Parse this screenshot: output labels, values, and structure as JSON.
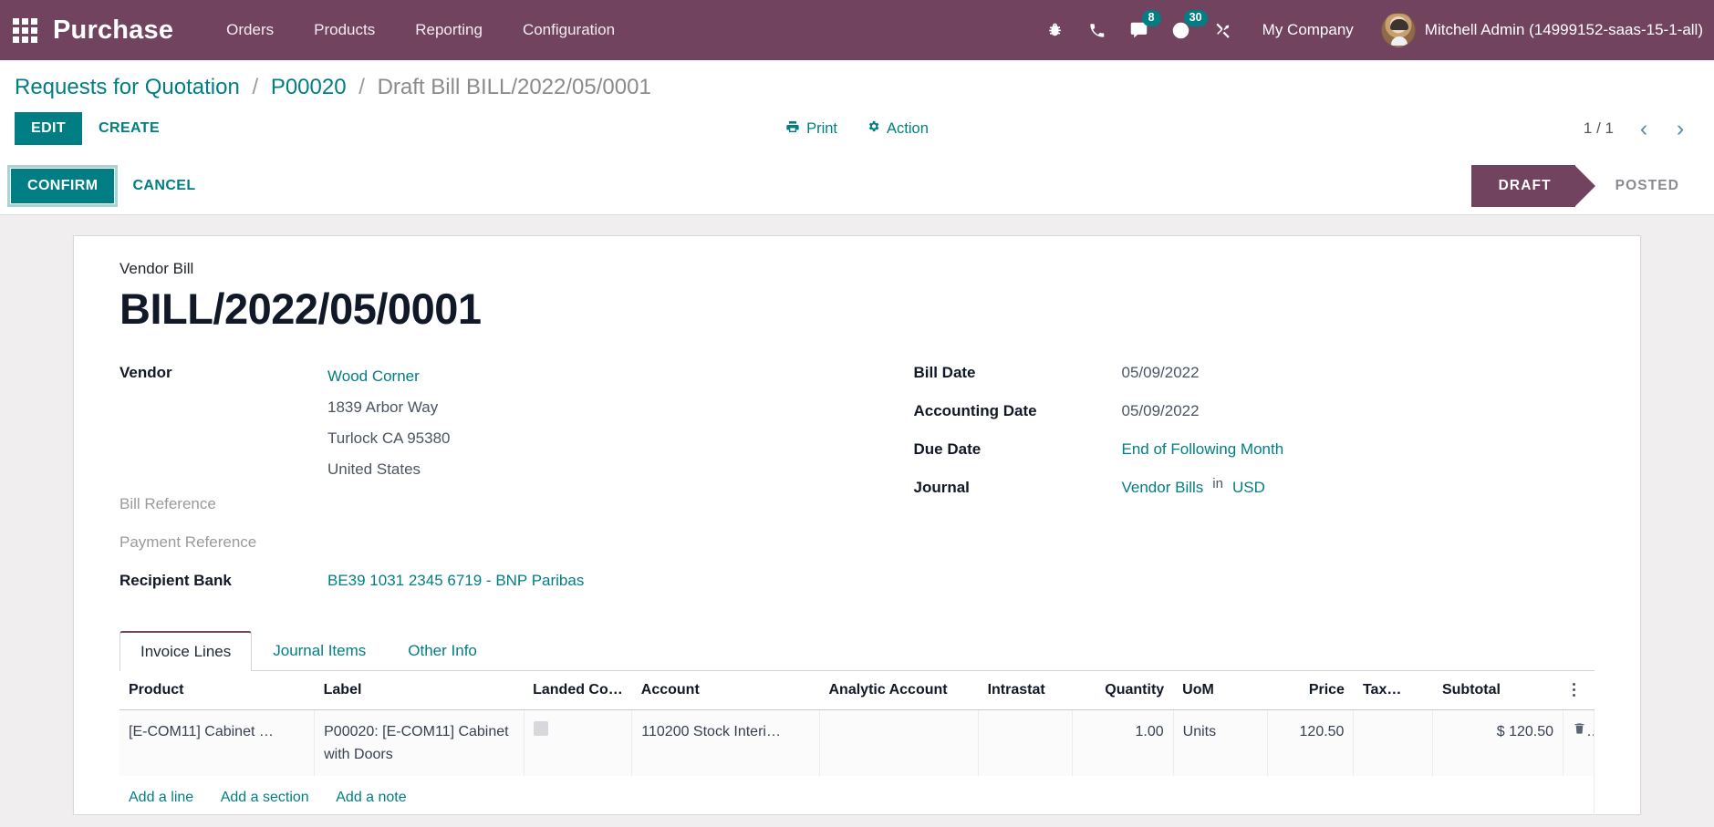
{
  "navbar": {
    "apps_icon": "apps-grid-icon",
    "brand": "Purchase",
    "menu": [
      {
        "label": "Orders"
      },
      {
        "label": "Products"
      },
      {
        "label": "Reporting"
      },
      {
        "label": "Configuration"
      }
    ],
    "sys_icons": [
      {
        "name": "bug-icon",
        "badge": ""
      },
      {
        "name": "phone-icon",
        "badge": ""
      },
      {
        "name": "messages-icon",
        "badge": "8"
      },
      {
        "name": "activities-clock-icon",
        "badge": "30"
      },
      {
        "name": "tools-wrench-icon",
        "badge": ""
      }
    ],
    "company": "My Company",
    "user": "Mitchell Admin (14999152-saas-15-1-all)",
    "brand_color": "#71435f",
    "accent_color": "#017e84"
  },
  "breadcrumb": {
    "root": "Requests for Quotation",
    "parent": "P00020",
    "current": "Draft Bill BILL/2022/05/0001",
    "separator": "/"
  },
  "control_panel": {
    "edit_label": "EDIT",
    "create_label": "CREATE",
    "print_label": "Print",
    "action_label": "Action",
    "print_icon": "printer-icon",
    "action_icon": "gear-icon",
    "pager_value": "1 / 1",
    "prev_icon": "chevron-left-icon",
    "next_icon": "chevron-right-icon"
  },
  "statusbar": {
    "confirm_label": "CONFIRM",
    "cancel_label": "CANCEL",
    "stages": [
      {
        "label": "DRAFT",
        "active": true
      },
      {
        "label": "POSTED",
        "active": false
      }
    ]
  },
  "document": {
    "subtitle": "Vendor Bill",
    "title": "BILL/2022/05/0001",
    "left_fields": [
      {
        "label": "Vendor",
        "muted": false
      },
      {
        "label": "Bill Reference",
        "muted": true,
        "value": ""
      },
      {
        "label": "Payment Reference",
        "muted": true,
        "value": ""
      },
      {
        "label": "Recipient Bank",
        "muted": false,
        "value": "BE39 1031 2345 6719 - BNP Paribas"
      }
    ],
    "vendor_address": [
      "Wood Corner",
      "1839 Arbor Way",
      "Turlock CA 95380",
      "United States"
    ],
    "right_fields": [
      {
        "label": "Bill Date",
        "value": "05/09/2022",
        "link": false
      },
      {
        "label": "Accounting Date",
        "value": "05/09/2022",
        "link": false
      },
      {
        "label": "Due Date",
        "value": "End of Following Month",
        "link": true
      },
      {
        "label": "Journal",
        "value": "Vendor Bills",
        "link": true,
        "joiner": "in",
        "value2": "USD"
      }
    ]
  },
  "tabs": [
    {
      "label": "Invoice Lines",
      "active": true
    },
    {
      "label": "Journal Items",
      "active": false
    },
    {
      "label": "Other Info",
      "active": false
    }
  ],
  "lines_table": {
    "columns": [
      "Product",
      "Label",
      "Landed Cos…",
      "Account",
      "Analytic Account",
      "Intrastat",
      "Quantity",
      "UoM",
      "Price",
      "Tax…",
      "Subtotal"
    ],
    "optional_columns_icon": "vertical-dots-icon",
    "rows": [
      {
        "product": "[E-COM11] Cabinet …",
        "label": "P00020: [E-COM11] Cabinet with Doors",
        "landed_cost": "",
        "account": "110200 Stock Interi…",
        "analytic_account": "",
        "intrastat": "",
        "quantity": "1.00",
        "uom": "Units",
        "price": "120.50",
        "tax": "",
        "subtotal": "$ 120.50",
        "delete_icon": "trash-icon"
      }
    ],
    "add_line_label": "Add a line",
    "add_section_label": "Add a section",
    "add_note_label": "Add a note"
  }
}
